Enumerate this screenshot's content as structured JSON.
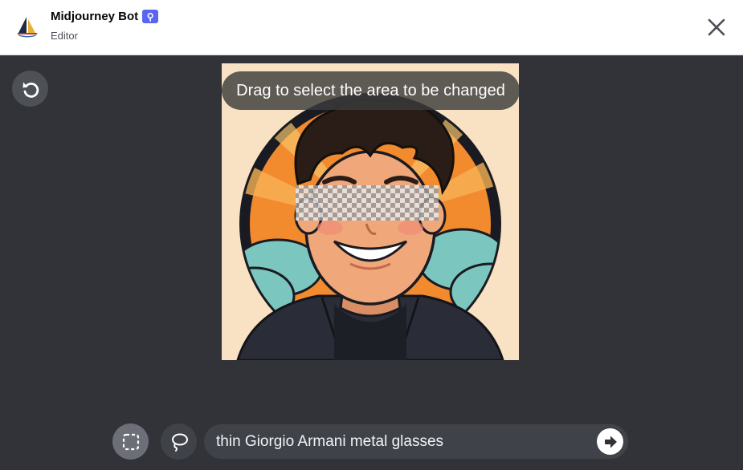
{
  "header": {
    "title": "Midjourney Bot",
    "badge": "⚲",
    "subtitle": "Editor",
    "avatar_icon": "midjourney-sailboat-logo",
    "close_icon": "close-x-icon"
  },
  "toolbar": {
    "undo_icon": "undo-arrow-icon"
  },
  "canvas": {
    "hint": "Drag to select the area to be changed",
    "image_description_icon": "cartoon-avatar-image",
    "selection_pattern": "checkerboard"
  },
  "bottom_bar": {
    "rect_tool_icon": "rectangle-select-icon",
    "lasso_tool_icon": "lasso-select-icon",
    "prompt_value": "thin Giorgio Armani metal glasses",
    "submit_icon": "arrow-right-icon"
  },
  "colors": {
    "background": "#313338",
    "header": "#ffffff",
    "badge": "#5865f2",
    "tool_active": "#6d6f78",
    "tool_inactive": "#404249"
  }
}
